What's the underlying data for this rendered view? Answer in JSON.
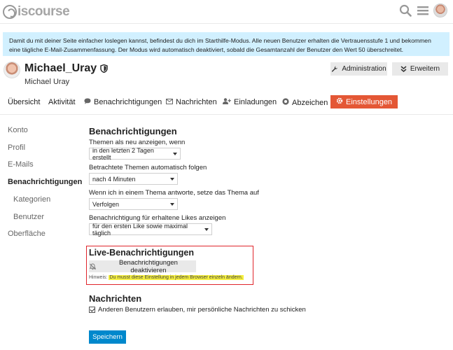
{
  "header": {
    "logo_text": "iscourse",
    "icons": [
      "search-icon",
      "hamburger-menu-icon",
      "avatar"
    ]
  },
  "banner": {
    "text": "Damit du mit deiner Seite einfacher loslegen kannst, befindest du dich im Starthilfe-Modus. Alle neuen Benutzer erhalten die Vertrauensstufe 1 und bekommen eine tägliche E-Mail-Zusammenfassung. Der Modus wird automatisch deaktiviert, sobald die Gesamtanzahl der Benutzer den Wert 50 überschreitet."
  },
  "user": {
    "username": "Michael_Uray",
    "full_name": "Michael Uray",
    "admin_button": "Administration",
    "expand_button": "Erweitern"
  },
  "nav": {
    "items": [
      {
        "label": "Übersicht",
        "icon": ""
      },
      {
        "label": "Aktivität",
        "icon": ""
      },
      {
        "label": "Benachrichtigungen",
        "icon": "comment-icon"
      },
      {
        "label": "Nachrichten",
        "icon": "envelope-icon"
      },
      {
        "label": "Einladungen",
        "icon": "user-plus-icon"
      },
      {
        "label": "Abzeichen",
        "icon": "certificate-icon"
      },
      {
        "label": "Einstellungen",
        "icon": "gear-icon"
      }
    ],
    "active": "Einstellungen"
  },
  "sidebar": {
    "items": [
      "Konto",
      "Profil",
      "E-Mails",
      "Benachrichtigungen",
      "Kategorien",
      "Benutzer",
      "Oberfläche"
    ],
    "active": "Benachrichtigungen"
  },
  "notifications": {
    "title": "Benachrichtigungen",
    "fields": [
      {
        "label": "Themen als neu anzeigen, wenn",
        "value": "in den letzten 2 Tagen erstellt"
      },
      {
        "label": "Betrachtete Themen automatisch folgen",
        "value": "nach 4 Minuten"
      },
      {
        "label": "Wenn ich in einem Thema antworte, setze das Thema auf",
        "value": "Verfolgen"
      },
      {
        "label": "Benachrichtigung für erhaltene Likes anzeigen",
        "value": "für den ersten Like sowie maximal täglich"
      }
    ]
  },
  "live": {
    "title": "Live-Benachrichtigungen",
    "button": "Benachrichtigungen deaktivieren",
    "hint_prefix": "Hinweis:",
    "hint_text": "Du musst diese Einstellung in jedem Browser einzeln ändern."
  },
  "messages": {
    "title": "Nachrichten",
    "checkbox_label": "Anderen Benutzern erlauben, mir persönliche Nachrichten zu schicken",
    "checked": true
  },
  "save_button": "Speichern",
  "colors": {
    "accent": "#e45735",
    "primary_button": "#0088cc",
    "banner_bg": "#d1f0ff",
    "highlight_box": "#e0252b",
    "hint_highlight": "#f6f03e"
  }
}
